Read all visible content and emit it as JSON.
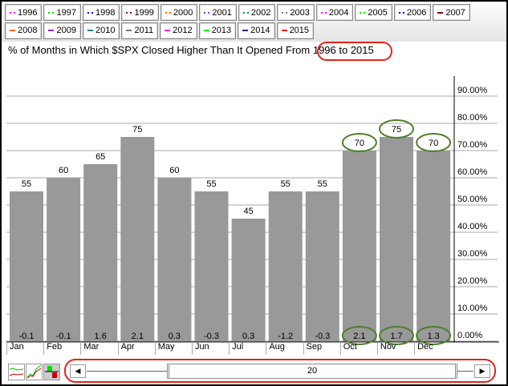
{
  "legend": [
    {
      "label": "1996",
      "color": "#ff00ff",
      "style": "dot"
    },
    {
      "label": "1997",
      "color": "#00dd00",
      "style": "dot"
    },
    {
      "label": "1998",
      "color": "#0000cc",
      "style": "dot"
    },
    {
      "label": "1999",
      "color": "#8b0000",
      "style": "dot"
    },
    {
      "label": "2000",
      "color": "#ff6600",
      "style": "dot"
    },
    {
      "label": "2001",
      "color": "#8a2be2",
      "style": "dot"
    },
    {
      "label": "2002",
      "color": "#008b8b",
      "style": "dot"
    },
    {
      "label": "2003",
      "color": "#777777",
      "style": "dot"
    },
    {
      "label": "2004",
      "color": "#ff00ff",
      "style": "dot"
    },
    {
      "label": "2005",
      "color": "#00ee00",
      "style": "dot"
    },
    {
      "label": "2006",
      "color": "#0000cc",
      "style": "dot"
    },
    {
      "label": "2007",
      "color": "#8b0000",
      "style": "solid"
    },
    {
      "label": "2008",
      "color": "#ff6600",
      "style": "solid"
    },
    {
      "label": "2009",
      "color": "#8a2be2",
      "style": "solid"
    },
    {
      "label": "2010",
      "color": "#008b8b",
      "style": "solid"
    },
    {
      "label": "2011",
      "color": "#777777",
      "style": "solid"
    },
    {
      "label": "2012",
      "color": "#ff00ff",
      "style": "solid"
    },
    {
      "label": "2013",
      "color": "#00ee00",
      "style": "solid"
    },
    {
      "label": "2014",
      "color": "#2020aa",
      "style": "solid"
    },
    {
      "label": "2015",
      "color": "#ff0000",
      "style": "solid"
    }
  ],
  "title_prefix": "% of Months in Which $SPX Closed Higher Than It Opened From",
  "title_range": "1996 to 2015",
  "chart_data": {
    "type": "bar",
    "title": "% of Months in Which $SPX Closed Higher Than It Opened From 1996 to 2015",
    "categories": [
      "Jan",
      "Feb",
      "Mar",
      "Apr",
      "May",
      "Jun",
      "Jul",
      "Aug",
      "Sep",
      "Oct",
      "Nov",
      "Dec"
    ],
    "values": [
      55,
      60,
      65,
      75,
      60,
      55,
      45,
      55,
      55,
      70,
      75,
      70
    ],
    "avg_change": [
      "-0.1",
      "-0.1",
      "1.6",
      "2.1",
      "0.3",
      "-0.3",
      "0.3",
      "-1.2",
      "-0.3",
      "2.1",
      "1.7",
      "1.3"
    ],
    "highlighted": [
      "Oct",
      "Nov",
      "Dec"
    ],
    "yticks": [
      "0.00%",
      "10.00%",
      "20.00%",
      "30.00%",
      "40.00%",
      "50.00%",
      "60.00%",
      "70.00%",
      "80.00%",
      "90.00%"
    ],
    "ylim": [
      0,
      100
    ],
    "bar_color": "#999999",
    "highlight_color": "#4f7f2a"
  },
  "scroller": {
    "value": "20"
  }
}
